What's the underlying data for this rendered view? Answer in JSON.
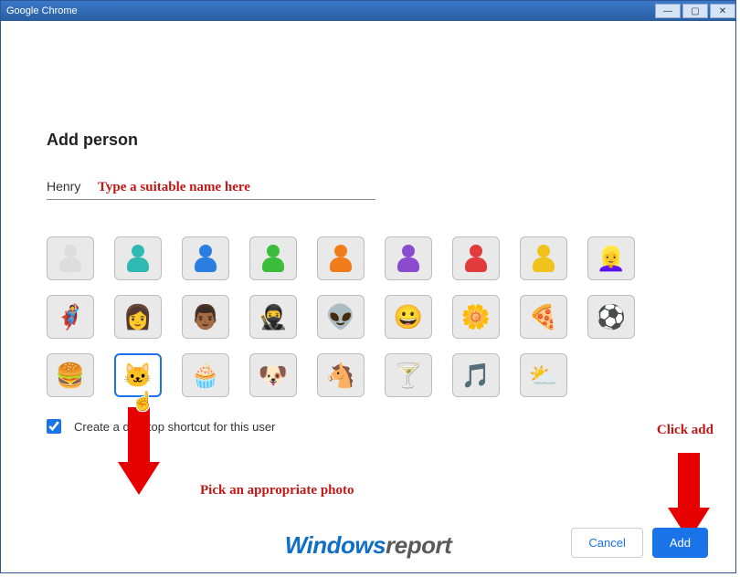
{
  "window": {
    "title": "Google Chrome"
  },
  "heading": "Add person",
  "name_input": {
    "value": "Henry"
  },
  "annotations": {
    "name_hint": "Type a suitable name here",
    "pick_photo": "Pick an appropriate photo",
    "click_add": "Click add"
  },
  "checkbox": {
    "label": "Create a desktop shortcut for this user",
    "checked": true
  },
  "buttons": {
    "cancel": "Cancel",
    "add": "Add"
  },
  "watermark": {
    "left": "Windows",
    "right": "report"
  },
  "avatars": [
    {
      "id": "silhouette-white",
      "kind": "sil",
      "color": "#dddddd"
    },
    {
      "id": "silhouette-teal",
      "kind": "sil",
      "color": "#2fb9b3"
    },
    {
      "id": "silhouette-blue",
      "kind": "sil",
      "color": "#2a7de1"
    },
    {
      "id": "silhouette-green",
      "kind": "sil",
      "color": "#3bbd3b"
    },
    {
      "id": "silhouette-orange",
      "kind": "sil",
      "color": "#f07c1b"
    },
    {
      "id": "silhouette-purple",
      "kind": "sil",
      "color": "#8a4bcf"
    },
    {
      "id": "silhouette-red",
      "kind": "sil",
      "color": "#e23b3b"
    },
    {
      "id": "silhouette-yellow",
      "kind": "sil",
      "color": "#f0c21b"
    },
    {
      "id": "female-blonde",
      "kind": "emoji",
      "glyph": "👱‍♀️"
    },
    {
      "id": "hero",
      "kind": "emoji",
      "glyph": "🦸"
    },
    {
      "id": "female-sunglasses",
      "kind": "emoji",
      "glyph": "👩"
    },
    {
      "id": "male-dark",
      "kind": "emoji",
      "glyph": "👨🏾"
    },
    {
      "id": "ninja",
      "kind": "emoji",
      "glyph": "🥷"
    },
    {
      "id": "alien",
      "kind": "emoji",
      "glyph": "👽"
    },
    {
      "id": "smiley",
      "kind": "emoji",
      "glyph": "😀"
    },
    {
      "id": "flower",
      "kind": "emoji",
      "glyph": "🌼"
    },
    {
      "id": "pizza",
      "kind": "emoji",
      "glyph": "🍕"
    },
    {
      "id": "soccer-ball",
      "kind": "emoji",
      "glyph": "⚽"
    },
    {
      "id": "burger",
      "kind": "emoji",
      "glyph": "🍔"
    },
    {
      "id": "cat",
      "kind": "emoji",
      "glyph": "🐱",
      "selected": true
    },
    {
      "id": "cupcake",
      "kind": "emoji",
      "glyph": "🧁"
    },
    {
      "id": "dog",
      "kind": "emoji",
      "glyph": "🐶"
    },
    {
      "id": "horse",
      "kind": "emoji",
      "glyph": "🐴"
    },
    {
      "id": "cocktail",
      "kind": "emoji",
      "glyph": "🍸"
    },
    {
      "id": "music-note",
      "kind": "emoji",
      "glyph": "🎵"
    },
    {
      "id": "sun-cloud",
      "kind": "emoji",
      "glyph": "⛅"
    }
  ]
}
